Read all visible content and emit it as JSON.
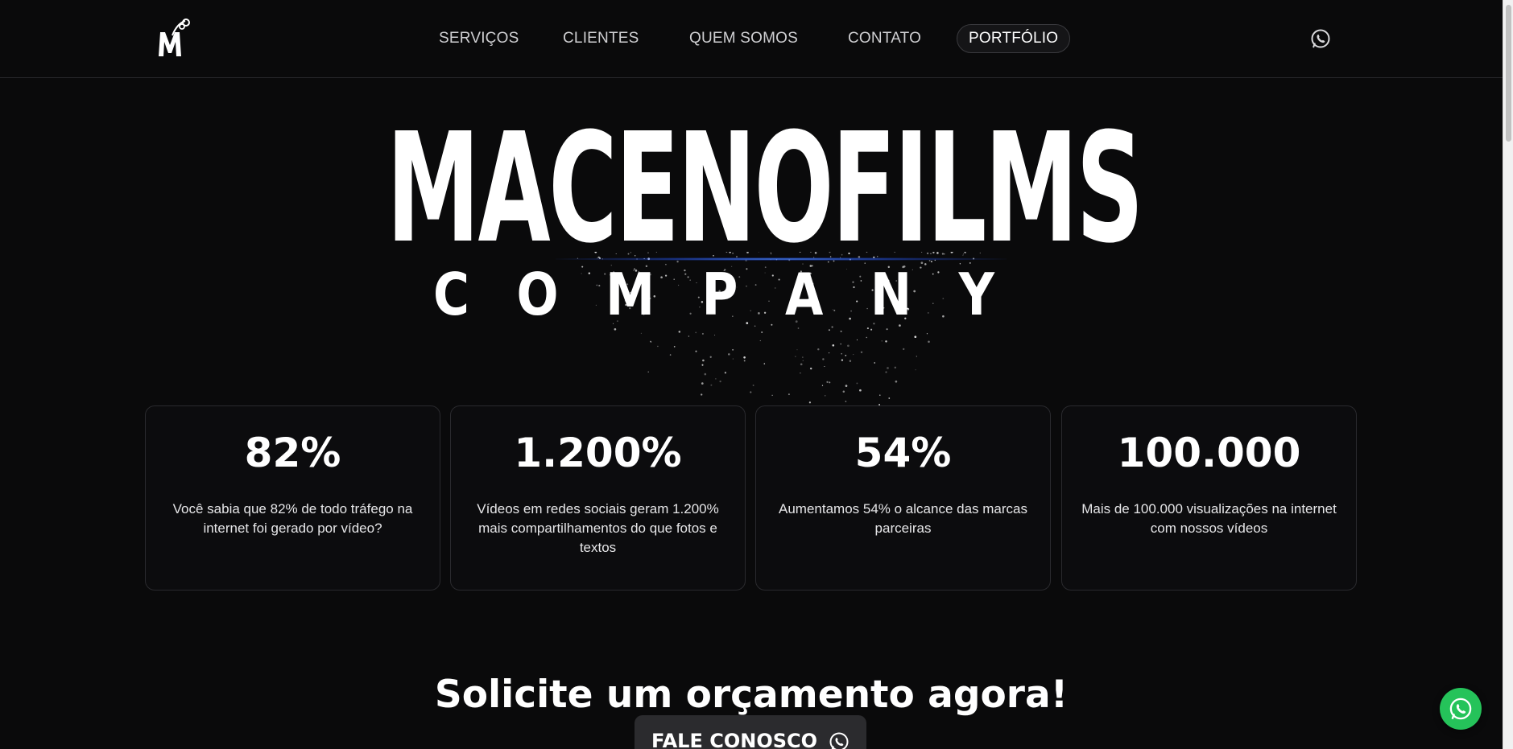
{
  "header": {
    "logo_icon": "macenofilms-m-logo-icon",
    "nav": [
      {
        "label": "SERVIÇOS"
      },
      {
        "label": "CLIENTES"
      },
      {
        "label": "QUEM SOMOS"
      },
      {
        "label": "CONTATO"
      },
      {
        "label": "PORTFÓLIO",
        "active": true
      }
    ],
    "whatsapp_icon": "whatsapp-icon"
  },
  "hero": {
    "brand": "MACENOFILMS",
    "sub_letters": [
      "C",
      "O",
      "M",
      "P",
      "A",
      "N",
      "Y"
    ]
  },
  "stats": [
    {
      "value": "82%",
      "description": "Você sabia que 82% de todo tráfego na internet foi gerado por vídeo?"
    },
    {
      "value": "1.200%",
      "description": "Vídeos em redes sociais geram 1.200% mais compartilhamentos do que fotos e textos"
    },
    {
      "value": "54%",
      "description": "Aumentamos 54% o alcance das marcas parceiras"
    },
    {
      "value": "100.000",
      "description": "Mais de 100.000 visualizações na internet com nossos vídeos"
    }
  ],
  "cta": {
    "title": "Solicite um orçamento agora!",
    "button_label": "FALE CONOSCO",
    "button_icon": "whatsapp-icon"
  },
  "floating_button": {
    "icon": "whatsapp-icon",
    "color": "#25c35a"
  },
  "colors": {
    "background": "#0a0a0b",
    "card_border": "#2a2a2e",
    "accent_glow": "#508cff"
  }
}
